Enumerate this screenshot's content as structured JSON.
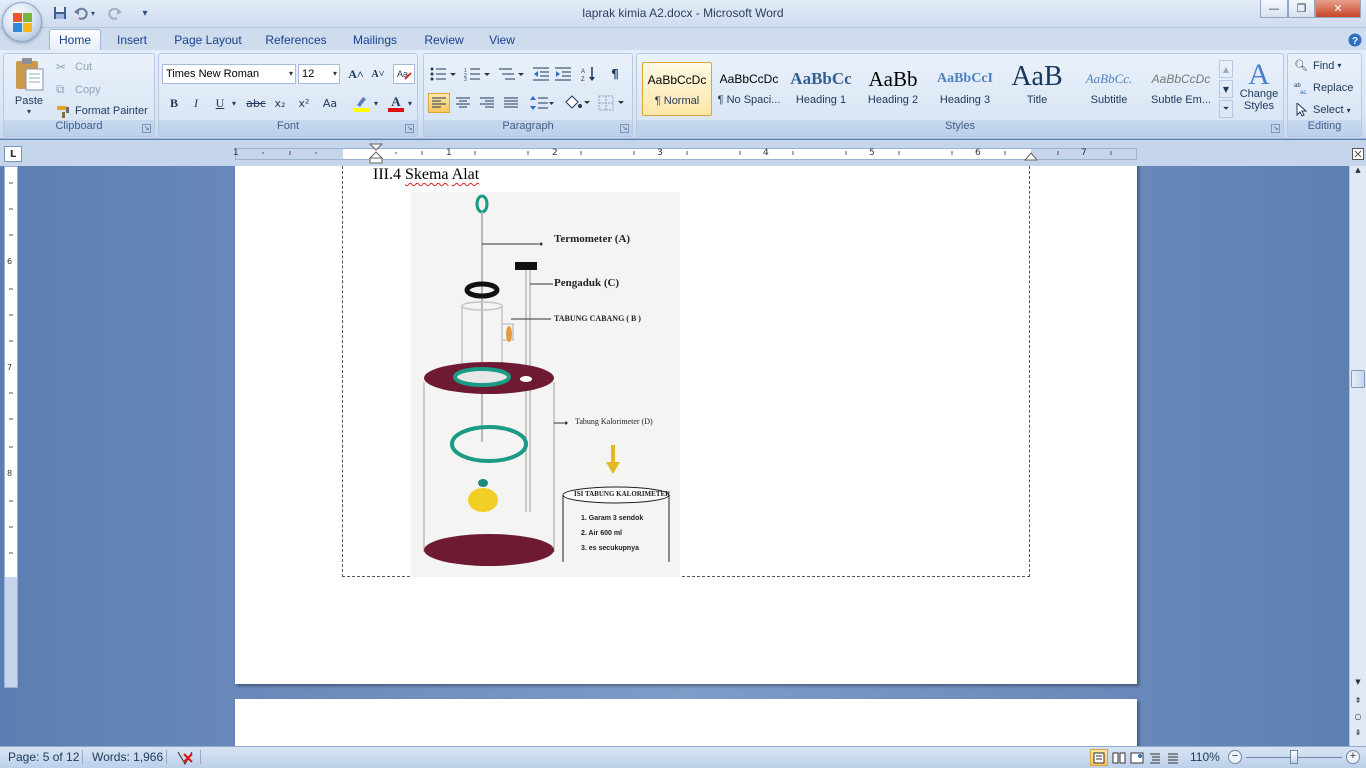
{
  "window": {
    "title": "laprak kimia A2.docx - Microsoft Word",
    "minimize": "—",
    "restore": "❐",
    "close": "✕"
  },
  "quick_access": {
    "customize_glyph": "▾"
  },
  "tabs": [
    {
      "label": "Home",
      "active": true
    },
    {
      "label": "Insert"
    },
    {
      "label": "Page Layout"
    },
    {
      "label": "References"
    },
    {
      "label": "Mailings"
    },
    {
      "label": "Review"
    },
    {
      "label": "View"
    }
  ],
  "clipboard": {
    "paste": "Paste",
    "cut": "Cut",
    "copy": "Copy",
    "format_painter": "Format Painter",
    "label": "Clipboard"
  },
  "font": {
    "family": "Times New Roman",
    "size": "12",
    "label": "Font",
    "grow": "A˄",
    "shrink": "A˅",
    "bold": "B",
    "italic": "I",
    "underline": "U",
    "strike": "abc",
    "subscript": "x₂",
    "superscript": "x²",
    "change_case": "Aa"
  },
  "paragraph": {
    "label": "Paragraph",
    "pilcrow": "¶"
  },
  "styles": {
    "label": "Styles",
    "items": [
      {
        "preview": "AaBbCcDc",
        "name": "¶ Normal",
        "selected": true
      },
      {
        "preview": "AaBbCcDc",
        "name": "¶ No Spaci..."
      },
      {
        "preview": "AaBbCc",
        "name": "Heading 1"
      },
      {
        "preview": "AaBb",
        "name": "Heading 2"
      },
      {
        "preview": "AaBbCcI",
        "name": "Heading 3"
      },
      {
        "preview": "AaB",
        "name": "Title"
      },
      {
        "preview": "AaBbCc.",
        "name": "Subtitle"
      },
      {
        "preview": "AaBbCcDc",
        "name": "Subtle Em..."
      }
    ],
    "change_styles": [
      "Change",
      "Styles"
    ]
  },
  "editing": {
    "label": "Editing",
    "find": "Find",
    "replace": "Replace",
    "select": "Select"
  },
  "ruler": {
    "h_numbers": [
      "1",
      "1",
      "2",
      "3",
      "4",
      "5",
      "6",
      "7"
    ],
    "v_numbers": [
      "6",
      "7",
      "8"
    ]
  },
  "document": {
    "heading_number": "III.4 ",
    "heading_word1": "Skema",
    "heading_word2": "Alat",
    "figure": {
      "labels": {
        "termometer": "Termometer (A)",
        "pengaduk": "Pengaduk (C)",
        "tabung_cabang": "TABUNG CABANG ( B )",
        "tabung_kalorimeter": "Tabung Kalorimeter (D)",
        "isi_title": "ISI TABUNG KALORIMETER",
        "isi_items": [
          "1. Garam 3 sendok",
          "2. Air 600 ml",
          "3. es secukupnya"
        ]
      }
    }
  },
  "status": {
    "page": "Page: 5 of 12",
    "words": "Words: 1,966",
    "zoom": "110%"
  }
}
